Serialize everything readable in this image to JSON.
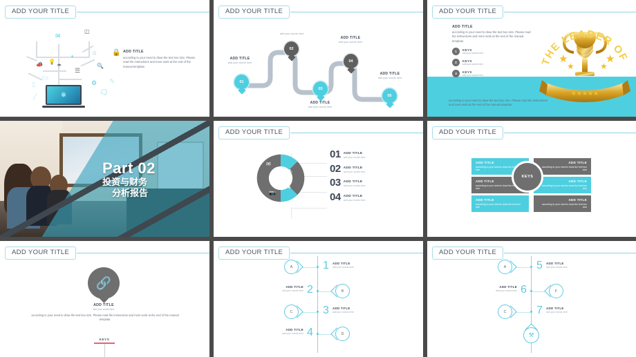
{
  "common": {
    "slide_title": "ADD YOUR TITLE",
    "add_title": "ADD TITLE",
    "body_text": "according to your need to draw the text box size.  Please read the instructions and more work at the end of the manual template.",
    "words_here": "add your words here",
    "keys_label": "KEYS"
  },
  "slides": [
    {
      "id": "slide-1-network-icons",
      "title": "ADD YOUR TITLE",
      "heading": "ADD TITLE",
      "body": "according to your need to draw the text box size.  Please read the instructions and more work at the end of the manual template.",
      "icons": [
        {
          "name": "envelope-icon",
          "glyph": "✉",
          "color": "#4ecfe0"
        },
        {
          "name": "lightbulb-icon",
          "glyph": "Ὂ1",
          "color": "#bfe9f2"
        },
        {
          "name": "database-icon",
          "glyph": "⛃",
          "color": "#6f6f6f"
        },
        {
          "name": "home-icon",
          "glyph": "⌂",
          "color": "#4ecfe0"
        },
        {
          "name": "lock-icon",
          "glyph": "ὑ2",
          "color": "#4ecfe0"
        },
        {
          "name": "wifi-icon",
          "glyph": "◠",
          "color": "#4ecfe0"
        },
        {
          "name": "megaphone-icon",
          "glyph": "὎3",
          "color": "#4ecfe0"
        },
        {
          "name": "server-stack-icon",
          "glyph": "☰",
          "color": "#6f6f6f"
        },
        {
          "name": "tablet-icon",
          "glyph": "▭",
          "color": "#8fd9e8"
        },
        {
          "name": "phone-icon",
          "glyph": "▯",
          "color": "#bfe9f2"
        },
        {
          "name": "gear-icon",
          "glyph": "⚙",
          "color": "#4ecfe0"
        },
        {
          "name": "pencil-icon",
          "glyph": "✎",
          "color": "#bfe9f2"
        },
        {
          "name": "chat-bubble-icon",
          "glyph": "὞8",
          "color": "#4ecfe0"
        },
        {
          "name": "search-icon",
          "glyph": "ὐD",
          "color": "#6f6f6f"
        },
        {
          "name": "scissors-icon",
          "glyph": "✂",
          "color": "#bfe9f2"
        },
        {
          "name": "umbrella-icon",
          "glyph": "☂",
          "color": "#6f6f6f"
        },
        {
          "name": "camera-icon",
          "glyph": "▣",
          "color": "#6f6f6f"
        },
        {
          "name": "laptop-icon",
          "glyph": "▭",
          "color": "#2f9ec2"
        }
      ]
    },
    {
      "id": "slide-2-winding-road",
      "title": "ADD YOUR TITLE",
      "steps": [
        {
          "num": "01",
          "color": "cyan",
          "title": "ADD TITLE",
          "sub": "add your words here",
          "label_pos": "above"
        },
        {
          "num": "02",
          "color": "gray",
          "title": "",
          "sub": "add your words here",
          "label_pos": "above"
        },
        {
          "num": "03",
          "color": "cyan",
          "title": "ADD TITLE",
          "sub": "add your words here",
          "label_pos": "below"
        },
        {
          "num": "04",
          "color": "gray",
          "title": "ADD TITLE",
          "sub": "add your words here",
          "label_pos": "above"
        },
        {
          "num": "05",
          "color": "cyan",
          "title": "ADD TITLE",
          "sub": "add your words here",
          "label_pos": "above"
        }
      ]
    },
    {
      "id": "slide-3-trophy-leader",
      "title": "ADD YOUR TITLE",
      "heading": "ADD TITLE",
      "body": "according to your need to draw the text box size. Please read the instructions and more work at the end of the manual template.",
      "keys": [
        {
          "num": "1",
          "title": "KEYS",
          "sub": "add your words here"
        },
        {
          "num": "2",
          "title": "KEYS",
          "sub": "add your words here"
        },
        {
          "num": "3",
          "title": "KEYS",
          "sub": "add your words here"
        }
      ],
      "footer": "according to your need to draw the text box size.  Please read the instructions and more work at the end of the manual template.",
      "trophy_arc_text": "THE LEADER OF THE YEAR",
      "band_color": "#4ecfe0"
    },
    {
      "id": "slide-4-part-divider",
      "part_label": "Part 02",
      "cn_line1": "投资与财务",
      "cn_line2": "分析报告",
      "overlay_color": "#38a5be"
    },
    {
      "id": "slide-5-donut",
      "title": "ADD YOUR TITLE",
      "segments": [
        {
          "icon": "envelope-icon",
          "glyph": "✉",
          "color": "#4ecfe0"
        },
        {
          "icon": "key-icon",
          "glyph": "⚷",
          "color": "#6f6f6f"
        },
        {
          "icon": "wand-icon",
          "glyph": "✦",
          "color": "#4ecfe0"
        },
        {
          "icon": "camera-icon",
          "glyph": "὏7",
          "color": "#6f6f6f"
        }
      ],
      "items": [
        {
          "num": "01",
          "title": "ADD TITLE",
          "sub": "add your words here"
        },
        {
          "num": "02",
          "title": "ADD TITLE",
          "sub": "add your words here"
        },
        {
          "num": "03",
          "title": "ADD TITLE",
          "sub": "add your words here"
        },
        {
          "num": "04",
          "title": "ADD TITLE",
          "sub": "add your words here"
        }
      ]
    },
    {
      "id": "slide-6-keys-boxes",
      "title": "ADD YOUR TITLE",
      "center_label": "KEYS",
      "boxes": [
        {
          "pos": "left-top",
          "color": "#4ecfe0",
          "title": "ADD TITLE",
          "body": "according to your need to draw the text box size"
        },
        {
          "pos": "right-top",
          "color": "#6f6f6f",
          "title": "ADD TITLE",
          "body": "according to your need to draw the text box size"
        },
        {
          "pos": "left-mid",
          "color": "#6f6f6f",
          "title": "ADD TITLE",
          "body": "according to your need to draw the text box size"
        },
        {
          "pos": "right-mid",
          "color": "#4ecfe0",
          "title": "ADD TITLE",
          "body": "according to your need to draw the text box size"
        },
        {
          "pos": "left-bot",
          "color": "#4ecfe0",
          "title": "ADD TITLE",
          "body": "according to your need to draw the text box size"
        },
        {
          "pos": "right-bot",
          "color": "#6f6f6f",
          "title": "ADD TITLE",
          "body": "according to your need to draw the text box size"
        }
      ]
    },
    {
      "id": "slide-7-chain",
      "title": "ADD YOUR TITLE",
      "icon": "chain-link-icon",
      "icon_glyph": "⚭",
      "caption_title": "ADD TITLE",
      "caption_sub": "add your words here",
      "body": "according to your need to draw the text box size.  Please read the instructions and more work at the end of the manual template.",
      "keys_label": "KEYS",
      "bar_color": "#e8616e"
    },
    {
      "id": "slide-8-timeline-1234",
      "title": "ADD YOUR TITLE",
      "rows": [
        {
          "letter": "A",
          "letter_side": "left",
          "num": "1",
          "title": "ADD TITLE",
          "sub": "add your words here"
        },
        {
          "letter": "B",
          "letter_side": "right",
          "num": "2",
          "title": "ADD TITLE",
          "sub": "add your words here"
        },
        {
          "letter": "C",
          "letter_side": "left",
          "num": "3",
          "title": "ADD TITLE",
          "sub": "add your words here"
        },
        {
          "letter": "D",
          "letter_side": "right",
          "num": "4",
          "title": "ADD TITLE",
          "sub": "add your words here"
        }
      ]
    },
    {
      "id": "slide-9-timeline-567",
      "title": "ADD YOUR TITLE",
      "rows": [
        {
          "letter": "A",
          "letter_side": "left",
          "num": "5",
          "title": "ADD TITLE",
          "sub": "add your words here"
        },
        {
          "letter": "F",
          "letter_side": "right",
          "num": "6",
          "title": "ADD TITLE",
          "sub": "add your words here"
        },
        {
          "letter": "C",
          "letter_side": "left",
          "num": "7",
          "title": "ADD TITLE",
          "sub": "add your words here"
        }
      ],
      "bottom_icon": "tools-icon",
      "bottom_icon_glyph": "⚒"
    }
  ],
  "theme": {
    "accent_cyan": "#4ecfe0",
    "accent_light": "#bfe9f2",
    "gray": "#6f6f6f",
    "dark_text": "#3d4757",
    "separator": "#4a4a4a"
  }
}
